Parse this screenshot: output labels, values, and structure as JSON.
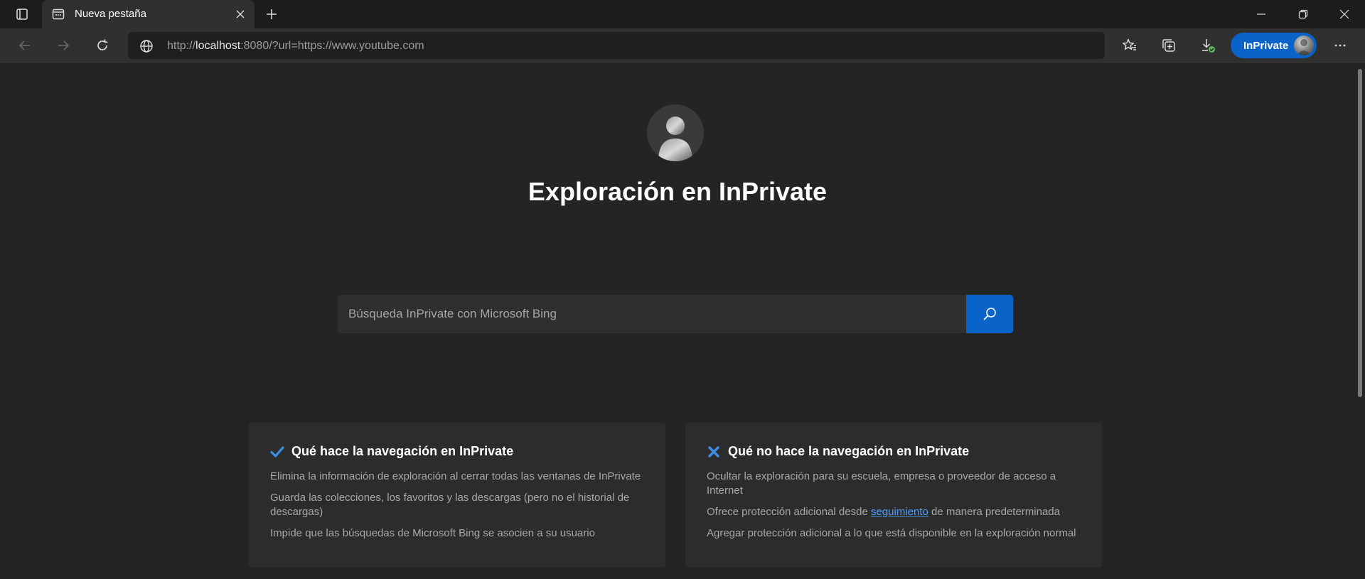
{
  "tab": {
    "title": "Nueva pestaña"
  },
  "address": {
    "prefix": "http://",
    "host": "localhost",
    "rest": ":8080/?url=https://www.youtube.com"
  },
  "profile": {
    "label": "InPrivate"
  },
  "colors": {
    "accent": "#0a63c9",
    "background": "#242424",
    "link": "#4aa0ff",
    "check": "#3b8ee8"
  },
  "page": {
    "title": "Exploración en InPrivate"
  },
  "search": {
    "placeholder": "Búsqueda InPrivate con Microsoft Bing"
  },
  "cards": [
    {
      "icon": "checkmark-icon",
      "heading": "Qué hace la navegación en InPrivate",
      "items": [
        "Elimina la información de exploración al cerrar todas las ventanas de InPrivate",
        "Guarda las colecciones, los favoritos y las descargas (pero no el historial de descargas)",
        "Impide que las búsquedas de Microsoft Bing se asocien a su usuario"
      ]
    },
    {
      "icon": "x-icon",
      "heading": "Qué no hace la navegación en InPrivate",
      "items": [
        "Ocultar la exploración para su escuela, empresa o proveedor de acceso a Internet",
        {
          "before": "Ofrece protección adicional desde ",
          "link": "seguimiento",
          "after": " de manera predeterminada"
        },
        "Agregar protección adicional a lo que está disponible en la exploración normal"
      ]
    }
  ]
}
